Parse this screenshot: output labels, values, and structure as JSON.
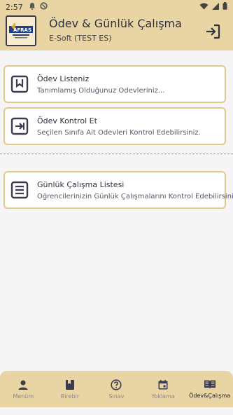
{
  "status_bar": {
    "time": "2:57"
  },
  "header": {
    "title": "Ödev & Günlük Çalışma",
    "subtitle": "E-Soft (TEST ES)",
    "logo_text": "AFRAS"
  },
  "cards": [
    {
      "title": "Ödev Listeniz",
      "description": "Tanımlamış Olduğunuz Ödevleriniz..."
    },
    {
      "title": "Ödev Kontrol Et",
      "description": "Seçilen Sınıfa Ait Ödevleri Kontrol Edebilirsiniz."
    },
    {
      "title": "Günlük Çalışma Listesi",
      "description": "Öğrencilerinizin Günlük Çalışmalarını Kontrol Edebilirsini..."
    }
  ],
  "bottom_nav": [
    {
      "label": "Menüm",
      "icon": "person-icon"
    },
    {
      "label": "Birebir",
      "icon": "book-icon"
    },
    {
      "label": "Sınav",
      "icon": "question-icon"
    },
    {
      "label": "Yoklama",
      "icon": "calendar-icon"
    },
    {
      "label": "Ödev&Çalışma",
      "icon": "open-book-icon",
      "active": true
    }
  ],
  "colors": {
    "header_bg": "#e9d4a3",
    "card_border": "#e2c98b",
    "icon_dark": "#3b3d4f",
    "bg": "#f5f5f5"
  }
}
